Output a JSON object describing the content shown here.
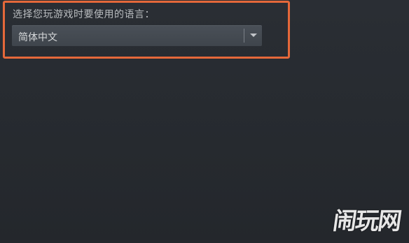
{
  "language_setting": {
    "label": "选择您玩游戏时要使用的语言：",
    "selected_value": "简体中文"
  },
  "watermark": {
    "text": "闹玩网"
  },
  "colors": {
    "background": "#272b30",
    "highlight_border": "#e5683a",
    "select_background": "#454b52",
    "text": "#d6d8da"
  },
  "icons": {
    "dropdown": "chevron-down-icon"
  }
}
